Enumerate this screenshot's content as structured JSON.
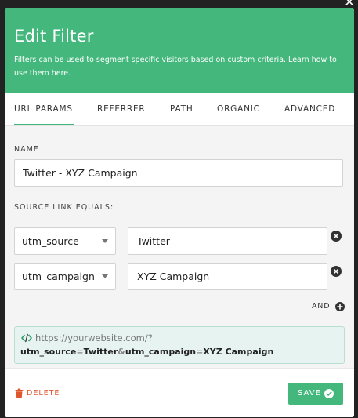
{
  "header": {
    "title": "Edit Filter",
    "description": "Filters can be used to segment specific visitors based on custom criteria. Learn how to use them here."
  },
  "tabs": [
    {
      "label": "URL PARAMS",
      "active": true
    },
    {
      "label": "REFERRER",
      "active": false
    },
    {
      "label": "PATH",
      "active": false
    },
    {
      "label": "ORGANIC",
      "active": false
    },
    {
      "label": "ADVANCED",
      "active": false
    }
  ],
  "form": {
    "name_label": "NAME",
    "name_value": "Twitter - XYZ Campaign",
    "source_label": "SOURCE LINK EQUALS:",
    "rows": [
      {
        "param": "utm_source",
        "value": "Twitter"
      },
      {
        "param": "utm_campaign",
        "value": "XYZ Campaign"
      }
    ],
    "and_label": "AND"
  },
  "preview": {
    "url": "https://yourwebsite.com/?",
    "params": [
      {
        "key": "utm_source",
        "eq": "=",
        "value": "Twitter",
        "sep": "&"
      },
      {
        "key": "utm_campaign",
        "eq": "=",
        "value": "XYZ Campaign",
        "sep": ""
      }
    ]
  },
  "footer": {
    "delete_label": "DELETE",
    "save_label": "SAVE"
  },
  "colors": {
    "accent": "#44b87c",
    "danger": "#e0572e",
    "preview_bg": "#e6f3f0"
  },
  "icons": {
    "close": "close-icon",
    "remove": "remove-circle-icon",
    "add": "add-circle-icon",
    "code": "code-icon",
    "trash": "trash-icon",
    "check": "check-circle-icon"
  }
}
